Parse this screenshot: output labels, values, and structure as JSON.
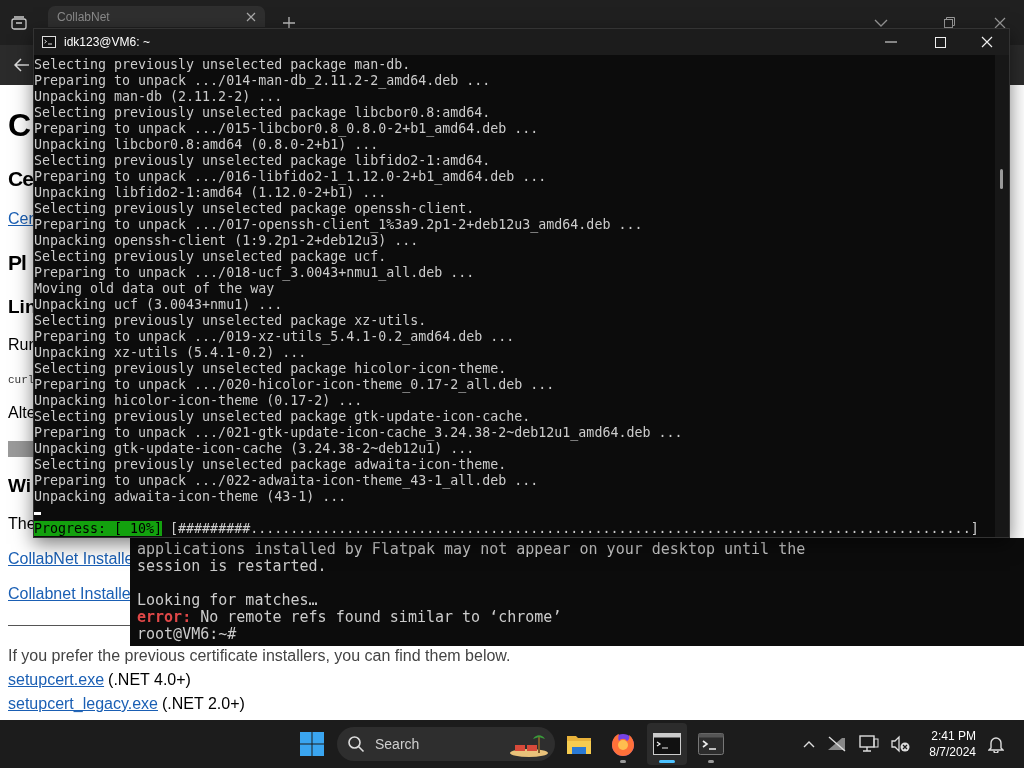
{
  "browser": {
    "tabs": [
      {
        "title": "CollabNet",
        "selected": true
      }
    ],
    "content": [
      {
        "kind": "h1",
        "text": "C"
      },
      {
        "kind": "h2",
        "text": "Ce"
      },
      {
        "kind": "link",
        "text": "Cer"
      },
      {
        "kind": "h2",
        "text": "Pl"
      },
      {
        "kind": "h3",
        "text": "Lin"
      },
      {
        "kind": "text",
        "text": "Rur"
      },
      {
        "kind": "code",
        "text": "curl"
      },
      {
        "kind": "text",
        "text": "Alte"
      },
      {
        "kind": "codeblock"
      },
      {
        "kind": "h3",
        "text": "Wi"
      },
      {
        "kind": "text",
        "text": "The"
      },
      {
        "kind": "link",
        "text": "CollabNet Installe"
      },
      {
        "kind": "link",
        "text": "Collabnet Installe"
      },
      {
        "kind": "rule"
      },
      {
        "kind": "text",
        "text": "If you prefer the previous certificate installers, you can find them below."
      },
      {
        "kind": "linkline",
        "link": "setupcert.exe",
        "text": "(.NET 4.0+)"
      },
      {
        "kind": "linkline",
        "link": "setupcert_legacy.exe",
        "text": "(.NET 2.0+)"
      }
    ]
  },
  "back_terminal": {
    "lines": [
      {
        "kind": "text",
        "text": "applications installed by Flatpak may not appear on your desktop until the"
      },
      {
        "kind": "text",
        "text": "session is restarted."
      },
      {
        "kind": "blank"
      },
      {
        "kind": "text",
        "text": "Looking for matches…"
      },
      {
        "kind": "error",
        "label": "error:",
        "text": "No remote refs found similar to ‘chrome’"
      },
      {
        "kind": "text",
        "text": "root@VM6:~#"
      }
    ]
  },
  "terminal": {
    "title": "idk123@VM6: ~",
    "lines": [
      "Selecting previously unselected package man-db.",
      "Preparing to unpack .../014-man-db_2.11.2-2_amd64.deb ...",
      "Unpacking man-db (2.11.2-2) ...",
      "Selecting previously unselected package libcbor0.8:amd64.",
      "Preparing to unpack .../015-libcbor0.8_0.8.0-2+b1_amd64.deb ...",
      "Unpacking libcbor0.8:amd64 (0.8.0-2+b1) ...",
      "Selecting previously unselected package libfido2-1:amd64.",
      "Preparing to unpack .../016-libfido2-1_1.12.0-2+b1_amd64.deb ...",
      "Unpacking libfido2-1:amd64 (1.12.0-2+b1) ...",
      "Selecting previously unselected package openssh-client.",
      "Preparing to unpack .../017-openssh-client_1%3a9.2p1-2+deb12u3_amd64.deb ...",
      "Unpacking openssh-client (1:9.2p1-2+deb12u3) ...",
      "Selecting previously unselected package ucf.",
      "Preparing to unpack .../018-ucf_3.0043+nmu1_all.deb ...",
      "Moving old data out of the way",
      "Unpacking ucf (3.0043+nmu1) ...",
      "Selecting previously unselected package xz-utils.",
      "Preparing to unpack .../019-xz-utils_5.4.1-0.2_amd64.deb ...",
      "Unpacking xz-utils (5.4.1-0.2) ...",
      "Selecting previously unselected package hicolor-icon-theme.",
      "Preparing to unpack .../020-hicolor-icon-theme_0.17-2_all.deb ...",
      "Unpacking hicolor-icon-theme (0.17-2) ...",
      "Selecting previously unselected package gtk-update-icon-cache.",
      "Preparing to unpack .../021-gtk-update-icon-cache_3.24.38-2~deb12u1_amd64.deb ...",
      "Unpacking gtk-update-icon-cache (3.24.38-2~deb12u1) ...",
      "Selecting previously unselected package adwaita-icon-theme.",
      "Preparing to unpack .../022-adwaita-icon-theme_43-1_all.deb ...",
      "Unpacking adwaita-icon-theme (43-1) ..."
    ],
    "progress": {
      "label": "Progress: [ 10%]",
      "bar": "[#########..........................................................................................]"
    }
  },
  "taskbar": {
    "search": {
      "placeholder": "Search"
    },
    "apps": [
      {
        "kind": "folder",
        "open": false,
        "selected": false
      },
      {
        "kind": "browser",
        "open": true,
        "selected": false
      },
      {
        "kind": "console",
        "open": true,
        "selected": true
      },
      {
        "kind": "terminal",
        "open": true,
        "selected": false
      }
    ],
    "clock": {
      "time": "2:41 PM",
      "date": "8/7/2024"
    }
  }
}
